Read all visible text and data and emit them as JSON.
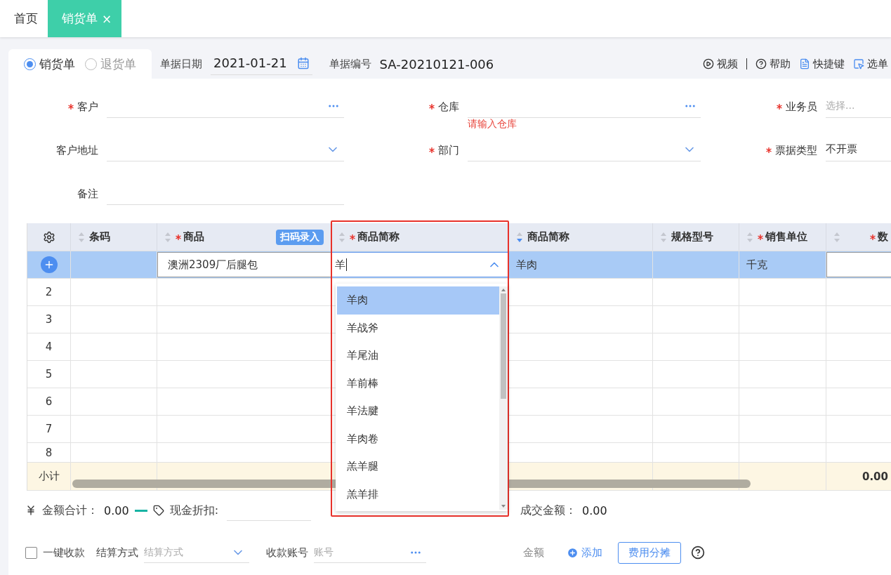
{
  "tabs": [
    {
      "label": "首页",
      "selected": false,
      "closable": false
    },
    {
      "label": "销货单",
      "selected": true,
      "closable": true,
      "close": "×"
    }
  ],
  "doc_type": [
    {
      "label": "销货单",
      "selected": true
    },
    {
      "label": "退货单",
      "selected": false
    }
  ],
  "header": {
    "date_label": "单据日期",
    "date": "2021-01-21",
    "number_label": "单据编号",
    "number": "SA-20210121-006"
  },
  "toolbar": [
    {
      "kind": "video",
      "label": "视频"
    },
    {
      "kind": "help",
      "label": "帮助"
    },
    {
      "kind": "shortcut",
      "label": "快捷键"
    },
    {
      "kind": "pick",
      "label": "选单"
    }
  ],
  "form": {
    "fields": [
      {
        "label": "客户",
        "required": true,
        "kind": "lookup"
      },
      {
        "label": "仓库",
        "required": true,
        "kind": "lookup",
        "error": "请输入仓库"
      },
      {
        "label": "业务员",
        "required": true,
        "kind": "text",
        "placeholder": "选择..."
      },
      {
        "label": "客户地址",
        "required": false,
        "kind": "select"
      },
      {
        "label": "部门",
        "required": true,
        "kind": "select"
      },
      {
        "label": "票据类型",
        "required": true,
        "kind": "text",
        "value": "不开票"
      },
      {
        "label": "备注",
        "required": false,
        "kind": "text"
      }
    ]
  },
  "table": {
    "columns": [
      {
        "label": "条码",
        "required": false,
        "sorted": false
      },
      {
        "label": "商品",
        "required": true,
        "sorted": false,
        "action": "扫码录入"
      },
      {
        "label": "商品简称",
        "required": true,
        "sorted": false
      },
      {
        "label": "商品简称",
        "required": false,
        "sorted": true
      },
      {
        "label": "规格型号",
        "required": false,
        "sorted": false
      },
      {
        "label": "销售单位",
        "required": true,
        "sorted": false
      },
      {
        "label": "数",
        "required": true,
        "sorted": false
      }
    ],
    "rows": [
      {
        "kind": "editing",
        "selected": true,
        "cells": [
          "",
          "澳洲2309厂后腿包",
          "羊",
          "羊肉",
          "",
          "千克",
          ""
        ]
      },
      {
        "kind": "empty",
        "selected": false,
        "no": "2"
      },
      {
        "kind": "empty",
        "selected": false,
        "no": "3"
      },
      {
        "kind": "empty",
        "selected": false,
        "no": "4"
      },
      {
        "kind": "empty",
        "selected": false,
        "no": "5"
      },
      {
        "kind": "empty",
        "selected": false,
        "no": "6"
      },
      {
        "kind": "empty",
        "selected": false,
        "no": "7"
      },
      {
        "kind": "empty",
        "selected": false,
        "no": "8"
      }
    ],
    "subtotal": {
      "label": "小计",
      "quantity": "0.00"
    }
  },
  "dropdown": {
    "options": [
      {
        "label": "羊肉",
        "selected": true
      },
      {
        "label": "羊战斧",
        "selected": false
      },
      {
        "label": "羊尾油",
        "selected": false
      },
      {
        "label": "羊前棒",
        "selected": false
      },
      {
        "label": "羊法腱",
        "selected": false
      },
      {
        "label": "羊肉卷",
        "selected": false
      },
      {
        "label": "羔羊腿",
        "selected": false
      },
      {
        "label": "羔羊排",
        "selected": false
      }
    ]
  },
  "totals": {
    "amount_label": "金额合计：",
    "amount": "0.00",
    "discount_label": "现金折扣:",
    "deal_label": "成交金额：",
    "deal": "0.00"
  },
  "payment": {
    "one_click": {
      "label": "一键收款",
      "checked": false
    },
    "method_label": "结算方式",
    "method_placeholder": "结算方式",
    "account_label": "收款账号",
    "account_placeholder": "账号",
    "amount_label": "金额",
    "add": "添加",
    "split": "费用分摊"
  }
}
